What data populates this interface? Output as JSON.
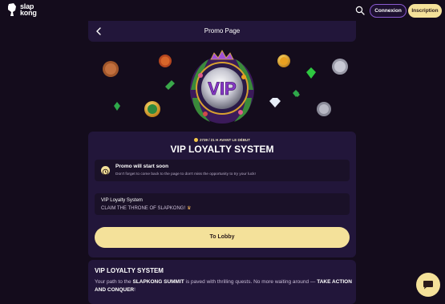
{
  "brand": {
    "line1": "slap",
    "line2": "kong"
  },
  "header": {
    "login_label": "Connexion",
    "signup_label": "Inscription"
  },
  "page": {
    "title": "Promo Page"
  },
  "hero": {
    "vip_text": "VIP"
  },
  "promo": {
    "countdown": "2739 / 21 H AVANT LE DÉBUT",
    "title": "VIP LOYALTY SYSTEM",
    "notice_title": "Promo will start soon",
    "notice_text": "Don't forget to come back to the page to don't miss the opportunity to try your luck!",
    "loyalty_name": "VIP Loyalty System",
    "loyalty_tagline": "CLAIM THE THRONE OF SLAPKONG!",
    "lobby_label": "To Lobby"
  },
  "description": {
    "title": "VIP LOYALTY SYSTEM",
    "text_1": "Your path to the ",
    "bold_1": "SLAPKONG SUMMIT",
    "text_2": " is paved with thrilling quests. No more waiting around — ",
    "bold_2": "TAKE ACTION AND CONQUER",
    "text_3": "!"
  },
  "colors": {
    "accent": "#f4e19a",
    "background": "#140c1c",
    "card": "#22163a",
    "outline": "#8a5ad0"
  }
}
